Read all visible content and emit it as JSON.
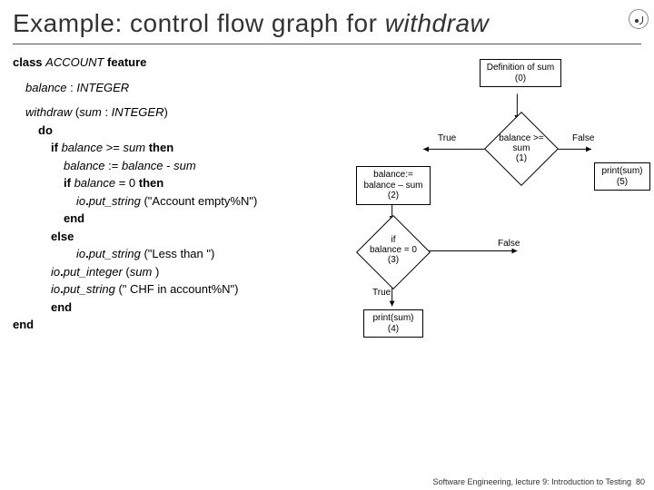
{
  "title_prefix": "Example: control flow graph for ",
  "title_italic": "withdraw",
  "code": {
    "l1a": "class ",
    "l1b": "ACCOUNT ",
    "l1c": "feature",
    "l2a": "balance ",
    "l2b": ": ",
    "l2c": "INTEGER",
    "l3a": "withdraw ",
    "l3b": "(",
    "l3c": "sum ",
    "l3d": ": ",
    "l3e": "INTEGER",
    "l3f": ")",
    "l4": "do",
    "l5a": "if ",
    "l5b": "balance ",
    "l5c": ">= ",
    "l5d": "sum ",
    "l5e": "then",
    "l6a": "balance ",
    "l6b": ":= ",
    "l6c": "balance ",
    "l6d": "- ",
    "l6e": "sum",
    "l7a": "if ",
    "l7b": "balance ",
    "l7c": "= 0 ",
    "l7d": "then",
    "l8a": "io",
    "l8b": "put_string ",
    "l8c": "(\"Account empty%N\")",
    "l9": "end",
    "l10": "else",
    "l11a": "io",
    "l11b": "put_string ",
    "l11c": "(\"Less than \")",
    "l12a": "io",
    "l12b": "put_integer ",
    "l12c": "(",
    "l12d": "sum ",
    "l12e": ")",
    "l13a": "io",
    "l13b": "put_string ",
    "l13c": "(\" CHF in account%N\")",
    "l14": "end",
    "l15": "end"
  },
  "chart_data": {
    "type": "flowchart",
    "nodes": [
      {
        "id": 0,
        "kind": "process",
        "label": "Definition of sum\n(0)"
      },
      {
        "id": 1,
        "kind": "decision",
        "label": "balance >=\nsum\n(1)"
      },
      {
        "id": 2,
        "kind": "process",
        "label": "balance:=\nbalance – sum\n(2)"
      },
      {
        "id": 3,
        "kind": "decision",
        "label": "if\nbalance = 0\n(3)"
      },
      {
        "id": 4,
        "kind": "process",
        "label": "print(sum)\n(4)"
      },
      {
        "id": 5,
        "kind": "process",
        "label": "print(sum)\n(5)"
      }
    ],
    "edges": [
      {
        "from": 0,
        "to": 1,
        "label": ""
      },
      {
        "from": 1,
        "to": 2,
        "label": "True"
      },
      {
        "from": 1,
        "to": 5,
        "label": "False"
      },
      {
        "from": 2,
        "to": 3,
        "label": ""
      },
      {
        "from": 3,
        "to": 4,
        "label": "True"
      },
      {
        "from": 3,
        "to": null,
        "label": "False"
      }
    ],
    "edge_labels": {
      "true": "True",
      "false": "False"
    }
  },
  "footer": "Software Engineering, lecture 9: Introduction to Testing",
  "footer_page": "80"
}
